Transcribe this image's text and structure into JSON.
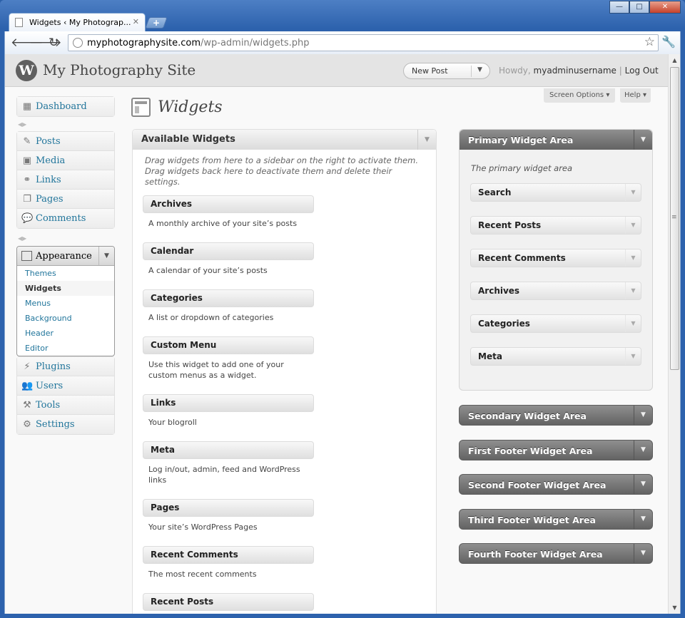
{
  "browser": {
    "tab_title": "Widgets ‹ My Photograp...",
    "url_host": "myphotographysite.com",
    "url_path": "/wp-admin/widgets.php"
  },
  "header": {
    "site_name": "My Photography Site",
    "new_post": "New Post",
    "howdy": "Howdy,",
    "username": "myadminusername",
    "separator": "|",
    "logout": "Log Out"
  },
  "screen_options": "Screen Options",
  "help": "Help",
  "menu": {
    "dashboard": "Dashboard",
    "posts": "Posts",
    "media": "Media",
    "links": "Links",
    "pages": "Pages",
    "comments": "Comments",
    "appearance": "Appearance",
    "submenu": [
      "Themes",
      "Widgets",
      "Menus",
      "Background",
      "Header",
      "Editor"
    ],
    "plugins": "Plugins",
    "users": "Users",
    "tools": "Tools",
    "settings": "Settings"
  },
  "page_title": "Widgets",
  "available": {
    "title": "Available Widgets",
    "description": "Drag widgets from here to a sidebar on the right to activate them. Drag widgets back here to deactivate them and delete their settings.",
    "widgets": [
      {
        "title": "Archives",
        "desc": "A monthly archive of your site’s posts"
      },
      {
        "title": "Calendar",
        "desc": "A calendar of your site’s posts"
      },
      {
        "title": "Categories",
        "desc": "A list or dropdown of categories"
      },
      {
        "title": "Custom Menu",
        "desc": "Use this widget to add one of your custom menus as a widget."
      },
      {
        "title": "Links",
        "desc": "Your blogroll"
      },
      {
        "title": "Meta",
        "desc": "Log in/out, admin, feed and WordPress links"
      },
      {
        "title": "Pages",
        "desc": "Your site’s WordPress Pages"
      },
      {
        "title": "Recent Comments",
        "desc": "The most recent comments"
      },
      {
        "title": "Recent Posts",
        "desc": ""
      }
    ]
  },
  "primary": {
    "title": "Primary Widget Area",
    "description": "The primary widget area",
    "widgets": [
      "Search",
      "Recent Posts",
      "Recent Comments",
      "Archives",
      "Categories",
      "Meta"
    ]
  },
  "other_areas": [
    "Secondary Widget Area",
    "First Footer Widget Area",
    "Second Footer Widget Area",
    "Third Footer Widget Area",
    "Fourth Footer Widget Area"
  ]
}
